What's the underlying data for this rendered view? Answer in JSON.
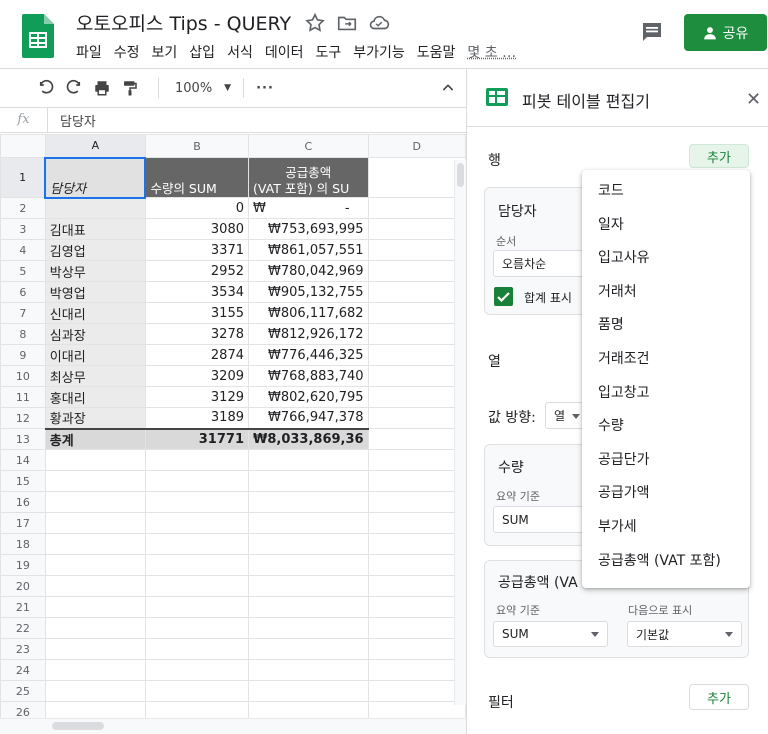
{
  "doc": {
    "title": "오토오피스 Tips - QUERY"
  },
  "menu": [
    "파일",
    "수정",
    "보기",
    "삽입",
    "서식",
    "데이터",
    "도구",
    "부가기능",
    "도움말",
    "몇 초 …"
  ],
  "share": {
    "label": "공유"
  },
  "toolbar": {
    "zoom": "100%"
  },
  "formula": {
    "fx": "fx",
    "value": "담당자"
  },
  "columns": [
    "A",
    "B",
    "C",
    "D"
  ],
  "rows": [
    "1",
    "2",
    "3",
    "4",
    "5",
    "6",
    "7",
    "8",
    "9",
    "10",
    "11",
    "12",
    "13",
    "14",
    "15",
    "16",
    "17",
    "18",
    "19",
    "20",
    "21",
    "22",
    "23",
    "24",
    "25",
    "26"
  ],
  "pivot_header": {
    "a": "담당자",
    "b": "수량의 SUM",
    "c_line1": "공급총액",
    "c_line2": "(VAT 포함) 의 SU"
  },
  "row2": {
    "b": "0",
    "c_sym": "₩",
    "c_val": "-"
  },
  "data_rows": [
    {
      "name": "김대표",
      "qty": "3080",
      "amt": "₩753,693,995"
    },
    {
      "name": "김영업",
      "qty": "3371",
      "amt": "₩861,057,551"
    },
    {
      "name": "박상무",
      "qty": "2952",
      "amt": "₩780,042,969"
    },
    {
      "name": "박영업",
      "qty": "3534",
      "amt": "₩905,132,755"
    },
    {
      "name": "신대리",
      "qty": "3155",
      "amt": "₩806,117,682"
    },
    {
      "name": "심과장",
      "qty": "3278",
      "amt": "₩812,926,172"
    },
    {
      "name": "이대리",
      "qty": "2874",
      "amt": "₩776,446,325"
    },
    {
      "name": "최상무",
      "qty": "3209",
      "amt": "₩768,883,740"
    },
    {
      "name": "홍대리",
      "qty": "3129",
      "amt": "₩802,620,795"
    },
    {
      "name": "황과장",
      "qty": "3189",
      "amt": "₩766,947,378"
    }
  ],
  "total_row": {
    "label": "총계",
    "qty": "31771",
    "amt": "₩8,033,869,36"
  },
  "panel": {
    "title": "피봇 테이블 편집기",
    "rows_label": "행",
    "add_label": "추가",
    "row_card": {
      "title": "담당자",
      "order_label": "순서",
      "order_value": "오름차순",
      "show_totals": "합계 표시"
    },
    "columns_label": "열",
    "values_direction_label": "값 방향:",
    "values_direction_value": "열",
    "value_card1": {
      "title": "수량",
      "summarize_label": "요약 기준",
      "summarize_value": "SUM"
    },
    "value_card2": {
      "title": "공급총액 (VA",
      "summarize_label": "요약 기준",
      "summarize_value": "SUM",
      "show_as_label": "다음으로 표시",
      "show_as_value": "기본값"
    },
    "filter_label": "필터",
    "filter_add": "추가"
  },
  "dropdown": [
    "코드",
    "일자",
    "입고사유",
    "거래처",
    "품명",
    "거래조건",
    "입고창고",
    "수량",
    "공급단가",
    "공급가액",
    "부가세",
    "공급총액 (VAT 포함)"
  ],
  "colors": {
    "accent": "#1e8e3e",
    "header_dark": "#666666",
    "selection": "#1a73e8"
  }
}
